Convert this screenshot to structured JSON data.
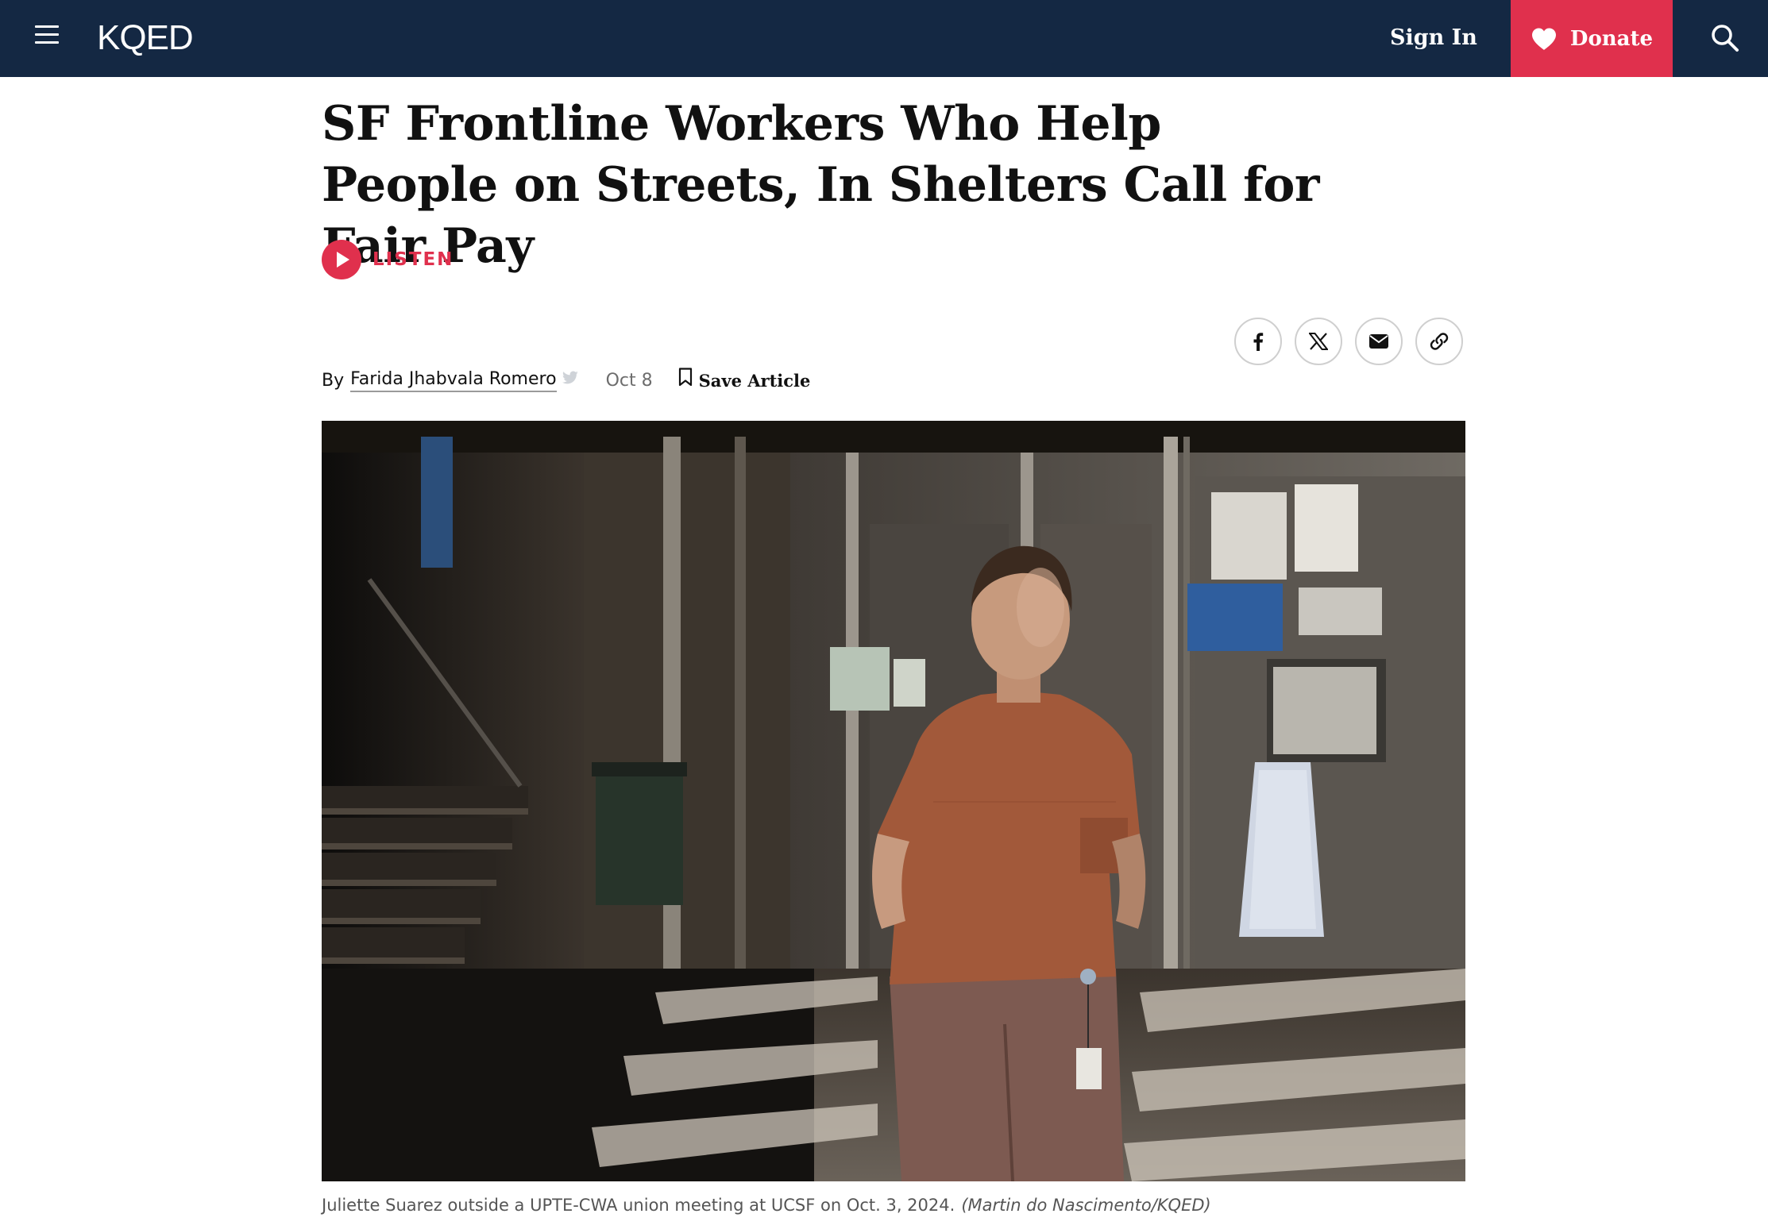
{
  "header": {
    "logo": "KQED",
    "sign_in": "Sign In",
    "donate": "Donate",
    "menu_icon": "hamburger-menu-icon",
    "search_icon": "search-icon",
    "heart_icon": "heart-icon",
    "colors": {
      "bar": "#142843",
      "donate": "#e0304d"
    }
  },
  "article": {
    "headline": "SF Frontline Workers Who Help People on Streets, In Shelters Call for Fair Pay",
    "listen_label": "LISTEN",
    "byline_prefix": "By",
    "author": "Farida Jhabvala Romero",
    "date": "Oct 8",
    "save_label": "Save Article",
    "share": [
      "facebook-icon",
      "x-icon",
      "email-icon",
      "link-icon"
    ],
    "accent": "#e0304d"
  },
  "photo": {
    "caption": "Juliette Suarez outside a UPTE-CWA union meeting at UCSF on Oct. 3, 2024.",
    "credit": "(Martin do Nascimento/KQED)"
  }
}
